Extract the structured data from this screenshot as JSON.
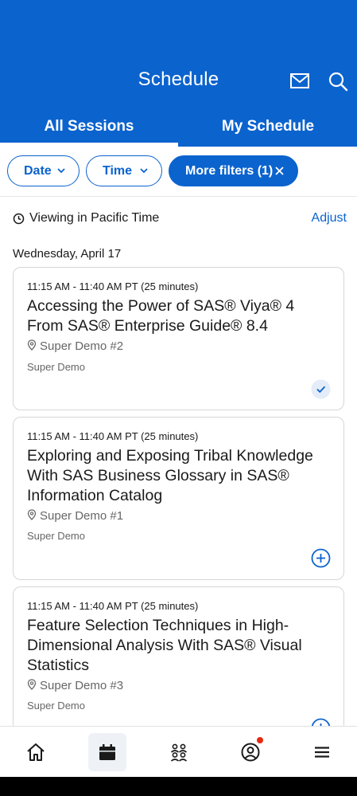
{
  "header": {
    "title": "Schedule",
    "tabs": [
      {
        "label": "All Sessions",
        "active": true
      },
      {
        "label": "My Schedule",
        "active": false
      }
    ]
  },
  "filters": {
    "date_label": "Date",
    "time_label": "Time",
    "more_label": "More filters (1)"
  },
  "timezone": {
    "text": "Viewing in Pacific Time",
    "adjust_label": "Adjust"
  },
  "day_label": "Wednesday, April 17",
  "sessions": [
    {
      "time": "11:15 AM - 11:40 AM PT (25 minutes)",
      "title": "Accessing the Power of SAS® Viya® 4 From SAS® Enterprise Guide® 8.4",
      "location": "Super Demo #2",
      "track": "Super Demo",
      "added": true
    },
    {
      "time": "11:15 AM - 11:40 AM PT (25 minutes)",
      "title": "Exploring and Exposing Tribal Knowledge With SAS Business Glossary in SAS® Information Catalog",
      "location": "Super Demo #1",
      "track": "Super Demo",
      "added": false
    },
    {
      "time": "11:15 AM - 11:40 AM PT (25 minutes)",
      "title": "Feature Selection Techniques in High-Dimensional Analysis With SAS® Visual Statistics",
      "location": "Super Demo #3",
      "track": "Super Demo",
      "added": false
    }
  ],
  "bottom_nav": [
    {
      "icon": "home-icon"
    },
    {
      "icon": "calendar-icon",
      "active": true
    },
    {
      "icon": "people-icon"
    },
    {
      "icon": "profile-icon",
      "badge": true
    },
    {
      "icon": "menu-icon"
    }
  ],
  "colors": {
    "brand": "#0b63ce",
    "badge": "#e8280f"
  }
}
